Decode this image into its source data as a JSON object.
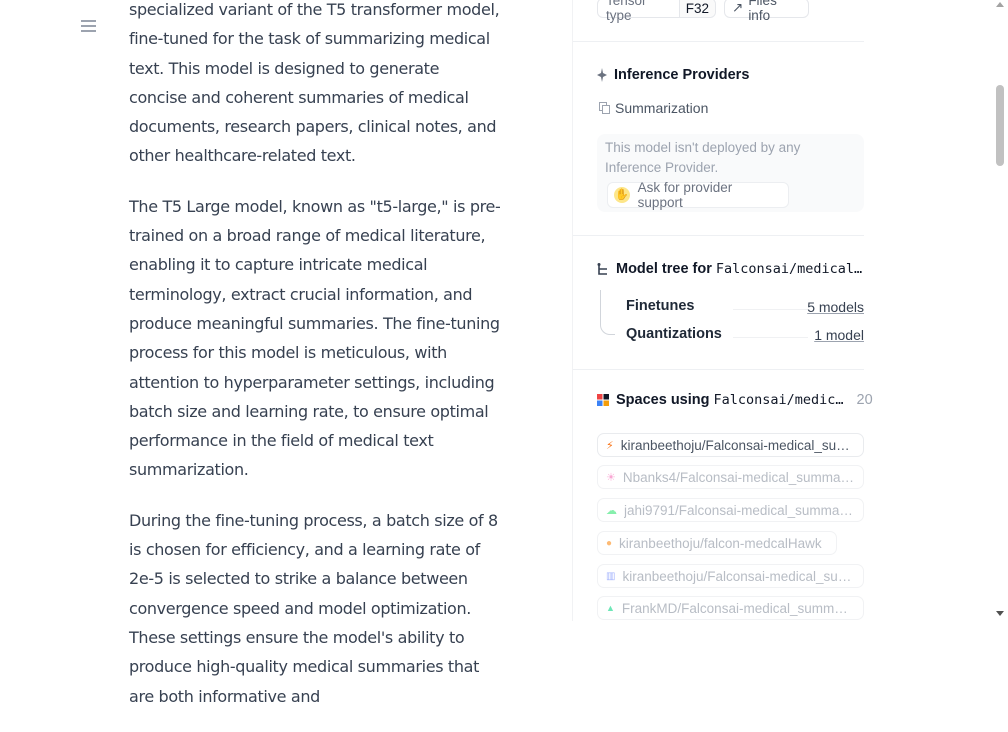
{
  "article": {
    "p1": "specialized variant of the T5 transformer model, fine-tuned for the task of summarizing medical text. This model is designed to generate concise and coherent summaries of medical documents, research papers, clinical notes, and other healthcare-related text.",
    "p2": "The T5 Large model, known as \"t5-large,\" is pre-trained on a broad range of medical literature, enabling it to capture intricate medical terminology, extract crucial information, and produce meaningful summaries. The fine-tuning process for this model is meticulous, with attention to hyperparameter settings, including batch size and learning rate, to ensure optimal performance in the field of medical text summarization.",
    "p3": "During the fine-tuning process, a batch size of 8 is chosen for efficiency, and a learning rate of 2e-5 is selected to strike a balance between convergence speed and model optimization. These settings ensure the model's ability to produce high-quality medical summaries that are both informative and"
  },
  "sidebar": {
    "tensor_type_label": "Tensor type",
    "tensor_type_value": "F32",
    "files_info": "Files info",
    "inference": {
      "title": "Inference Providers",
      "task": "Summarization",
      "message": "This model isn't deployed by any Inference Provider.",
      "ask_button": "Ask for provider support"
    },
    "model_tree": {
      "title": "Model tree for",
      "repo": "Falconsai/medical…",
      "rows": [
        {
          "label": "Finetunes",
          "link": "5 models"
        },
        {
          "label": "Quantizations",
          "link": "1 model"
        }
      ]
    },
    "spaces": {
      "title": "Spaces using",
      "repo": "Falconsai/medic…",
      "count": "20",
      "items": [
        {
          "name": "kiranbeethoju/Falconsai-medical_su…",
          "icon": "⚡"
        },
        {
          "name": "Nbanks4/Falconsai-medical_summa…",
          "icon": "☀"
        },
        {
          "name": "jahi9791/Falconsai-medical_summar…",
          "icon": "☁"
        },
        {
          "name": "kiranbeethoju/falcon-medcalHawk",
          "icon": "●"
        },
        {
          "name": "kiranbeethoju/Falconsai-medical_su…",
          "icon": "▥"
        },
        {
          "name": "FrankMD/Falconsai-medical_summa…",
          "icon": "▲"
        }
      ]
    }
  },
  "colors": {
    "accent_orange": "#f97316",
    "text_main": "#374151",
    "border": "#e5e7eb"
  }
}
